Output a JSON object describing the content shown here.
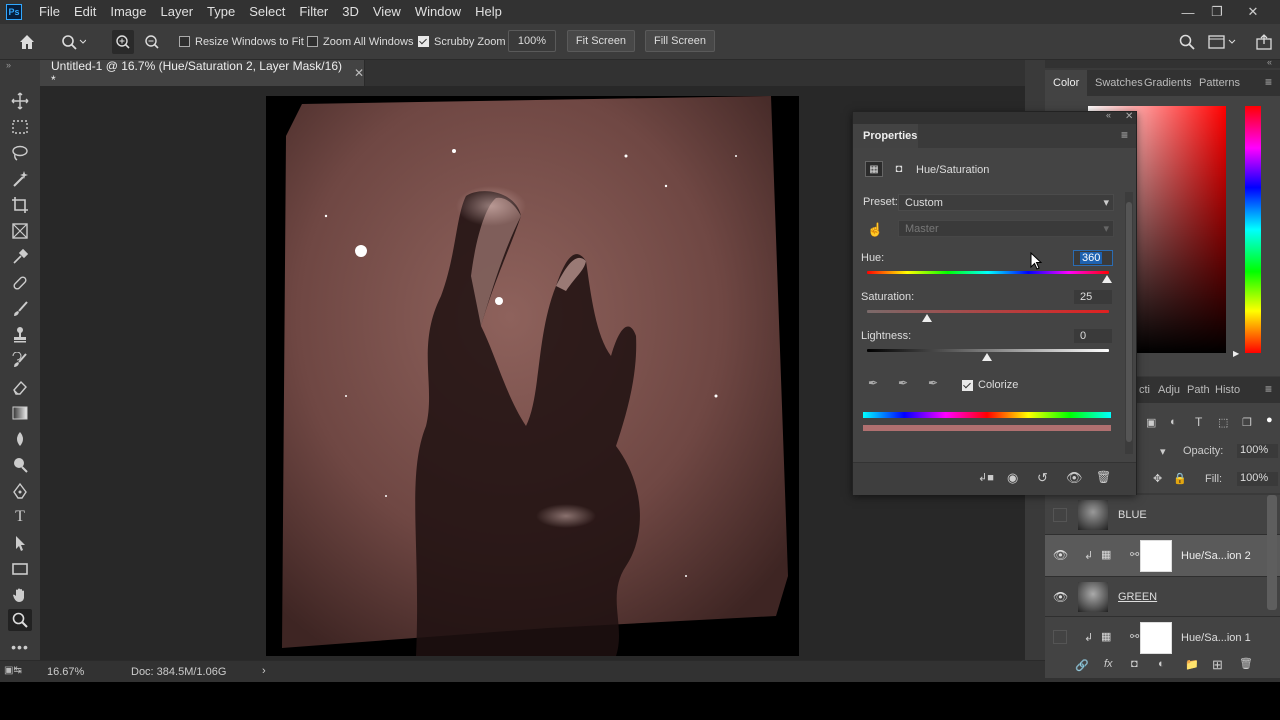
{
  "menu": [
    "File",
    "Edit",
    "Image",
    "Layer",
    "Type",
    "Select",
    "Filter",
    "3D",
    "View",
    "Window",
    "Help"
  ],
  "app_logo": "Ps",
  "options": {
    "resize_windows": "Resize Windows to Fit",
    "zoom_all": "Zoom All Windows",
    "scrubby": "Scrubby Zoom",
    "zoom_value": "100%",
    "fit_screen": "Fit Screen",
    "fill_screen": "Fill Screen"
  },
  "document": {
    "tab_title": "Untitled-1 @ 16.7% (Hue/Saturation 2, Layer Mask/16) *"
  },
  "status": {
    "zoom": "16.67%",
    "doc": "Doc: 384.5M/1.06G"
  },
  "panels": {
    "top_tabs": [
      "Color",
      "Swatches",
      "Gradients",
      "Patterns"
    ],
    "layer_tabs": [
      "cti",
      "Adju",
      "Path",
      "Histo"
    ],
    "opacity_label": "Opacity:",
    "opacity_value": "100%",
    "fill_label": "Fill:",
    "fill_value": "100%"
  },
  "properties": {
    "title": "Properties",
    "adjustment_name": "Hue/Saturation",
    "preset_label": "Preset:",
    "preset_value": "Custom",
    "channel_value": "Master",
    "hue_label": "Hue:",
    "hue_value": "360",
    "saturation_label": "Saturation:",
    "saturation_value": "25",
    "lightness_label": "Lightness:",
    "lightness_value": "0",
    "colorize_label": "Colorize"
  },
  "layers": [
    {
      "name": "BLUE",
      "visible": false,
      "type": "image"
    },
    {
      "name": "Hue/Sa...ion 2",
      "visible": true,
      "type": "adjustment"
    },
    {
      "name": "GREEN",
      "visible": true,
      "type": "image"
    },
    {
      "name": "Hue/Sa...ion 1",
      "visible": false,
      "type": "adjustment"
    }
  ],
  "colors": {
    "accent": "#31a8ff",
    "nebula_tint": "#8a5a55"
  }
}
